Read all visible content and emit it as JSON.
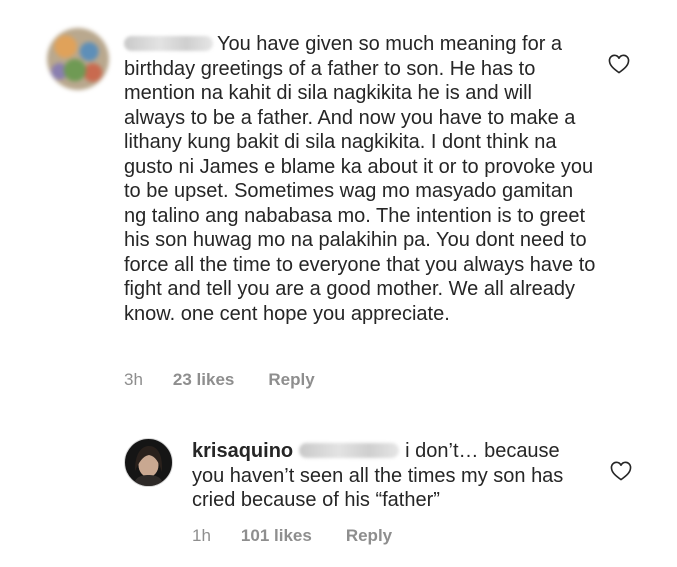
{
  "comments": [
    {
      "username": "triplaugh",
      "text": "You have given so much meaning for a birthday greetings of a father to son. He has to mention na kahit di sila nagkikita he is and will always to be a father. And now you have to make a lithany kung bakit di sila nagkikita. I dont think na gusto ni James e blame ka about it or to provoke you to be upset. Sometimes wag mo masyado gamitan ng talino ang nababasa mo. The intention is to greet his son huwag mo na palakihin pa. You dont need to force all the time to everyone that you always have to fight and tell you are a good mother. We all already know. one cent hope you appreciate.",
      "time": "3h",
      "likes": "23 likes",
      "reply_label": "Reply",
      "like_icon": "heart-outline-icon"
    },
    {
      "username": "krisaquino",
      "mention": "@triplaugh",
      "text": "i don’t… because you haven’t seen all the times my son has cried because of his “father”",
      "time": "1h",
      "likes": "101 likes",
      "reply_label": "Reply",
      "like_icon": "heart-outline-icon"
    }
  ],
  "colors": {
    "text": "#262626",
    "meta": "#8e8e8e",
    "background": "#ffffff"
  }
}
